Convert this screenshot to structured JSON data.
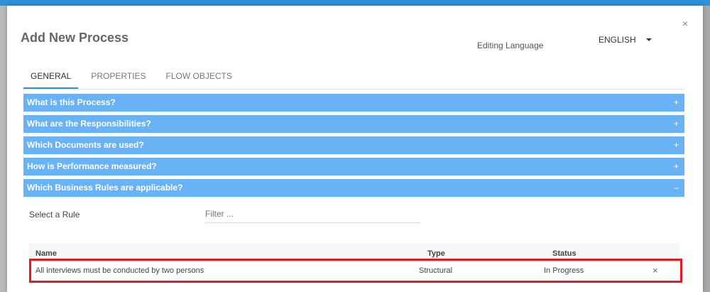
{
  "modal": {
    "title": "Add New Process",
    "close_glyph": "×",
    "editing_language_label": "Editing Language",
    "language_value": "ENGLISH"
  },
  "tabs": [
    {
      "label": "GENERAL",
      "active": true
    },
    {
      "label": "PROPERTIES",
      "active": false
    },
    {
      "label": "FLOW OBJECTS",
      "active": false
    }
  ],
  "accordion": [
    {
      "label": "What is this Process?",
      "sign": "+"
    },
    {
      "label": "What are the Responsibilities?",
      "sign": "+"
    },
    {
      "label": "Which Documents are used?",
      "sign": "+"
    },
    {
      "label": "How is Performance measured?",
      "sign": "+"
    },
    {
      "label": "Which Business Rules are applicable?",
      "sign": "–"
    }
  ],
  "rules": {
    "select_label": "Select a Rule",
    "filter_placeholder": "Filter ...",
    "columns": [
      "Name",
      "Type",
      "Status"
    ],
    "rows": [
      {
        "name": "All interviews must be conducted by two persons",
        "type": "Structural",
        "status": "In Progress",
        "remove_glyph": "×"
      }
    ]
  },
  "colors": {
    "accent": "#2d90d8",
    "accordion": "#69b3f5",
    "highlight": "#e01b22"
  }
}
